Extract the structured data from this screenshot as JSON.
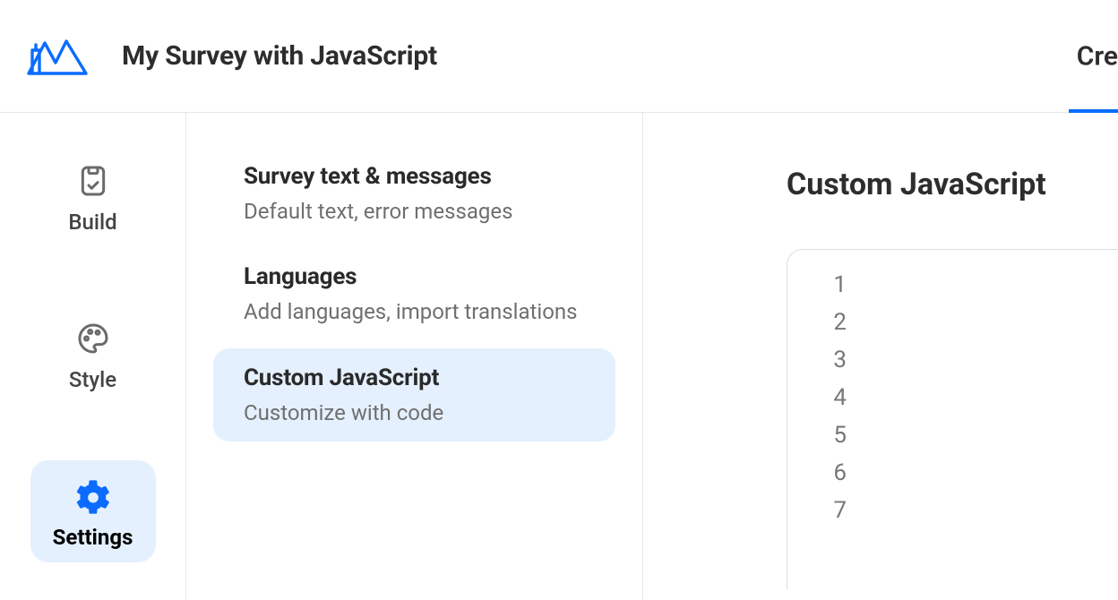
{
  "header": {
    "title": "My Survey with JavaScript",
    "tab_partial": "Cre"
  },
  "sidebar": {
    "items": [
      {
        "label": "Build",
        "icon": "clipboard-icon",
        "active": false
      },
      {
        "label": "Style",
        "icon": "palette-icon",
        "active": false
      },
      {
        "label": "Settings",
        "icon": "gear-icon",
        "active": true
      }
    ]
  },
  "settings": {
    "entries": [
      {
        "title": "Survey text & messages",
        "sub": "Default text, error messages",
        "selected": false
      },
      {
        "title": "Languages",
        "sub": "Add languages, import translations",
        "selected": false
      },
      {
        "title": "Custom JavaScript",
        "sub": "Customize with code",
        "selected": true
      }
    ]
  },
  "panel": {
    "heading": "Custom JavaScript",
    "line_numbers": [
      "1",
      "2",
      "3",
      "4",
      "5",
      "6",
      "7"
    ]
  }
}
